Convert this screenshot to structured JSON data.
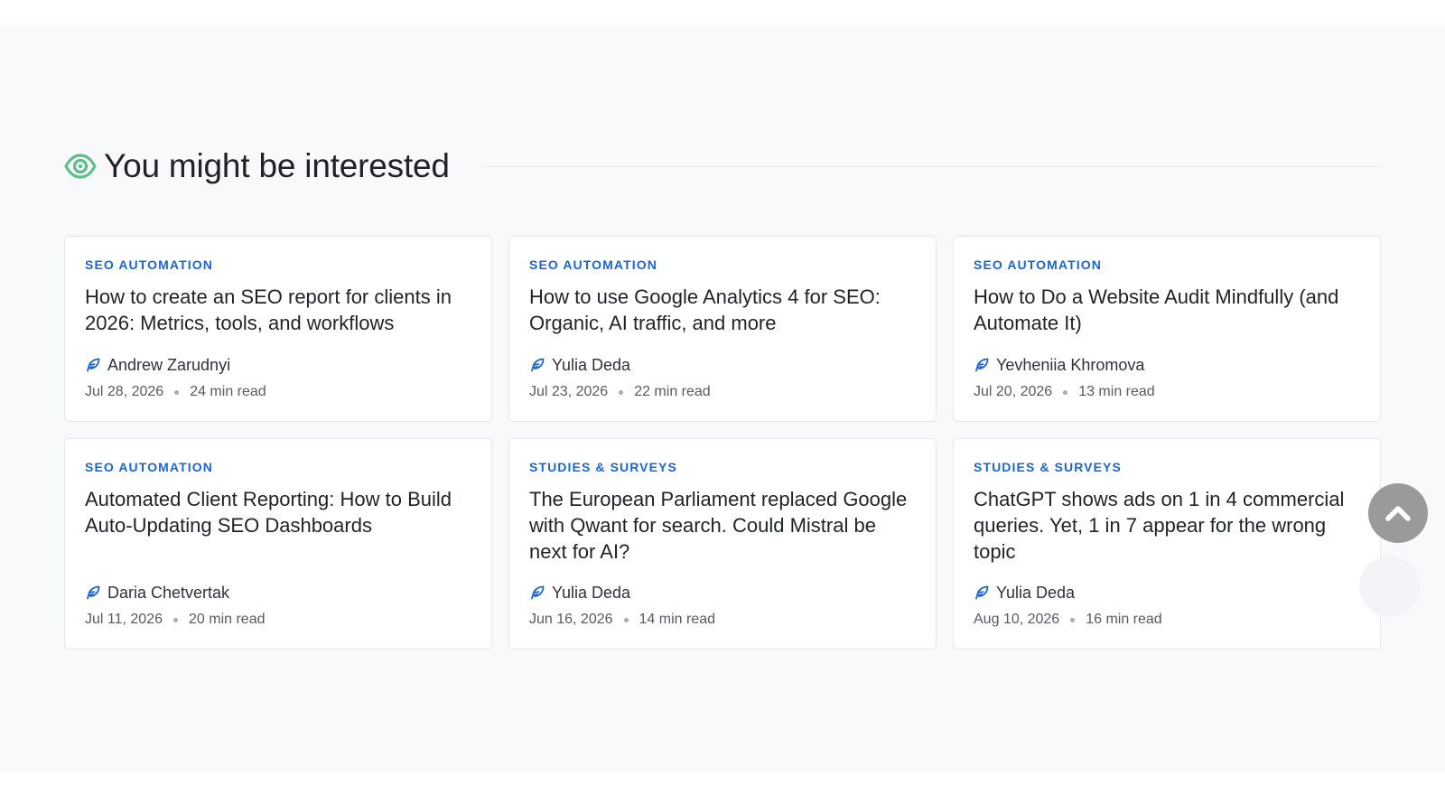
{
  "section": {
    "title": "You might be interested",
    "icon": "eye-icon",
    "accent": "#5bbf8a"
  },
  "colors": {
    "category": "#1a66d2",
    "author_icon": "#1a66d2",
    "scroll_button": "#9a9a9a"
  },
  "articles": [
    {
      "category": "SEO AUTOMATION",
      "title": "How to create an SEO report for clients in 2026: Metrics, tools, and workflows",
      "author": "Andrew Zarudnyi",
      "date": "Jul 28, 2026",
      "read_time": "24 min read"
    },
    {
      "category": "SEO AUTOMATION",
      "title": "How to use Google Analytics 4 for SEO: Organic, AI traffic, and more",
      "author": "Yulia Deda",
      "date": "Jul 23, 2026",
      "read_time": "22 min read"
    },
    {
      "category": "SEO AUTOMATION",
      "title": "How to Do a Website Audit Mindfully (and Automate It)",
      "author": "Yevheniia Khromova",
      "date": "Jul 20, 2026",
      "read_time": "13 min read"
    },
    {
      "category": "SEO AUTOMATION",
      "title": "Automated Client Reporting: How to Build Auto-Updating SEO Dashboards",
      "author": "Daria Chetvertak",
      "date": "Jul 11, 2026",
      "read_time": "20 min read"
    },
    {
      "category": "STUDIES & SURVEYS",
      "title": "The European Parliament replaced Google with Qwant for search. Could Mistral be next for AI?",
      "author": "Yulia Deda",
      "date": "Jun 16, 2026",
      "read_time": "14 min read"
    },
    {
      "category": "STUDIES & SURVEYS",
      "title": "ChatGPT shows ads on 1 in 4 commercial queries. Yet, 1 in 7 appear for the wrong topic",
      "author": "Yulia Deda",
      "date": "Aug 10, 2026",
      "read_time": "16 min read"
    }
  ],
  "scroll_top": {
    "icon": "chevron-up-icon"
  }
}
